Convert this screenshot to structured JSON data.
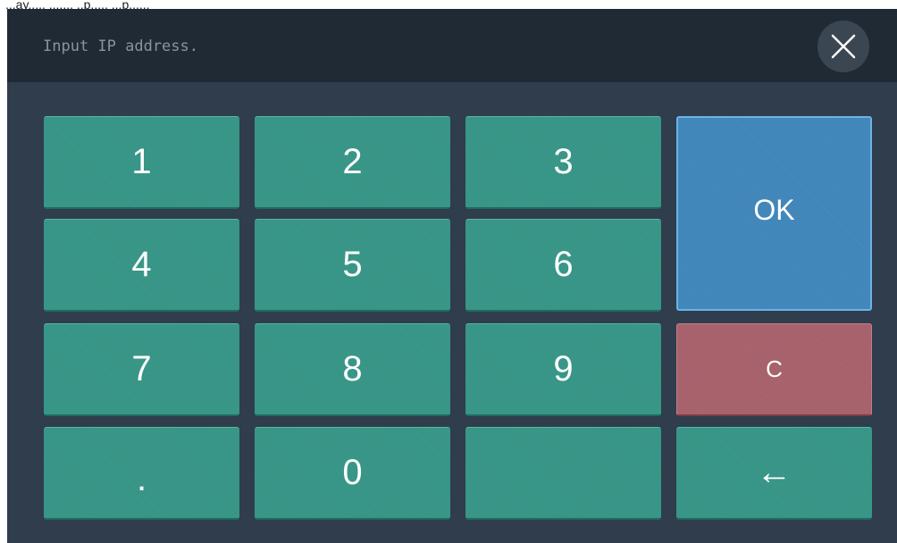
{
  "top_text": "...ay...., ....... ..p..... ...p......",
  "header": {
    "prompt": "Input IP address.",
    "close_icon": "close-icon"
  },
  "keypad": {
    "k1": "1",
    "k2": "2",
    "k3": "3",
    "k4": "4",
    "k5": "5",
    "k6": "6",
    "k7": "7",
    "k8": "8",
    "k9": "9",
    "dot": ".",
    "k0": "0",
    "blank": "",
    "ok": "OK",
    "clear": "C",
    "backspace": "←"
  },
  "colors": {
    "panel": "#2f3d4c",
    "header": "#1f2a35",
    "number_key": "#359485",
    "ok_key": "#3f85b9",
    "clear_key": "#a6606a"
  }
}
